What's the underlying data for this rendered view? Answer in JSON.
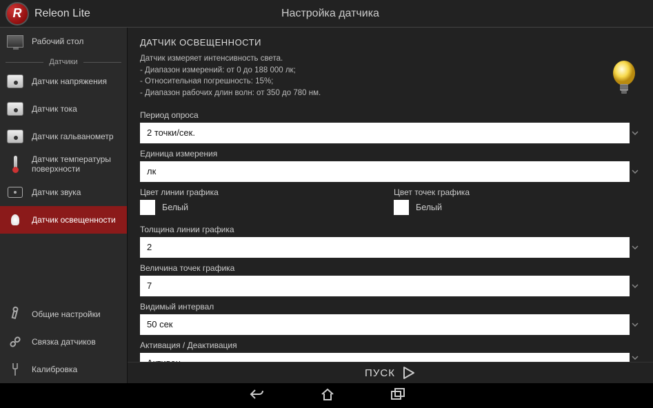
{
  "app_title": "Releon Lite",
  "page_title": "Настройка датчика",
  "sidebar": {
    "desktop": "Рабочий стол",
    "group_label": "Датчики",
    "items": [
      {
        "label": "Датчик напряжения"
      },
      {
        "label": "Датчик тока"
      },
      {
        "label": "Датчик гальванометр"
      },
      {
        "label": "Датчик температуры поверхности"
      },
      {
        "label": "Датчик звука"
      },
      {
        "label": "Датчик освещенности"
      }
    ],
    "footer": [
      {
        "label": "Общие настройки"
      },
      {
        "label": "Связка датчиков"
      },
      {
        "label": "Калибровка"
      }
    ],
    "active_index": 5
  },
  "main": {
    "section_title": "ДАТЧИК ОСВЕЩЕННОСТИ",
    "desc_line1": "Датчик измеряет интенсивность света.",
    "desc_line2": "- Диапазон измерений: от 0 до 188 000 лк;",
    "desc_line3": "- Относительная погрешность: 15%;",
    "desc_line4": "- Диапазон рабочих длин волн: от 350 до 780 нм.",
    "fields": {
      "poll_period": {
        "label": "Период опроса",
        "value": "2 точки/сек."
      },
      "unit": {
        "label": "Единица измерения",
        "value": "лк"
      },
      "line_color": {
        "label": "Цвет линии графика",
        "value": "Белый",
        "hex": "#ffffff"
      },
      "point_color": {
        "label": "Цвет точек графика",
        "value": "Белый",
        "hex": "#ffffff"
      },
      "line_width": {
        "label": "Толщина линии графика",
        "value": "2"
      },
      "point_size": {
        "label": "Величина точек графика",
        "value": "7"
      },
      "interval": {
        "label": "Видимый интервал",
        "value": "50 сек"
      },
      "activation": {
        "label": "Активация / Деактивация",
        "value": "Активен"
      }
    }
  },
  "start_label": "ПУСК"
}
